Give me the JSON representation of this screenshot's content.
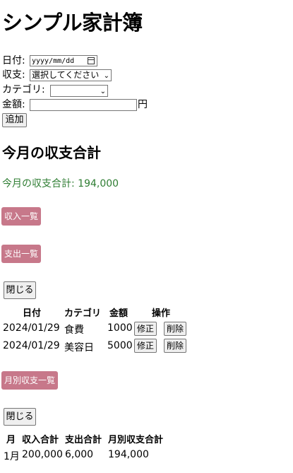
{
  "app": {
    "title": "シンプル家計簿"
  },
  "form": {
    "date_label": "日付:",
    "date_placeholder": "yyyy/mm/dd",
    "type_label": "収支:",
    "type_selected": "選択してください",
    "category_label": "カテゴリ:",
    "category_selected": "",
    "amount_label": "金額:",
    "amount_value": "",
    "amount_unit": "円",
    "add_button": "追加"
  },
  "summary": {
    "heading": "今月の収支合計",
    "total_text": "今月の収支合計: 194,000"
  },
  "income_list": {
    "label": "収入一覧"
  },
  "expense_list": {
    "label": "支出一覧",
    "close_button": "閉じる",
    "headers": [
      "日付",
      "カテゴリ",
      "金額",
      "操作"
    ],
    "rows": [
      {
        "date": "2024/01/29",
        "category": "食費",
        "amount": "1000",
        "edit": "修正",
        "delete": "削除"
      },
      {
        "date": "2024/01/29",
        "category": "美容日",
        "amount": "5000",
        "edit": "修正",
        "delete": "削除"
      }
    ]
  },
  "monthly_list": {
    "label": "月別収支一覧",
    "close_button": "閉じる",
    "headers": [
      "月",
      "収入合計",
      "支出合計",
      "月別収支合計"
    ],
    "rows": [
      {
        "month": "1月",
        "income": "200,000",
        "expense": "6,000",
        "balance": "194,000"
      }
    ]
  },
  "colors": {
    "accent_pill": "#c7788a",
    "total_green": "#2e7d32"
  }
}
